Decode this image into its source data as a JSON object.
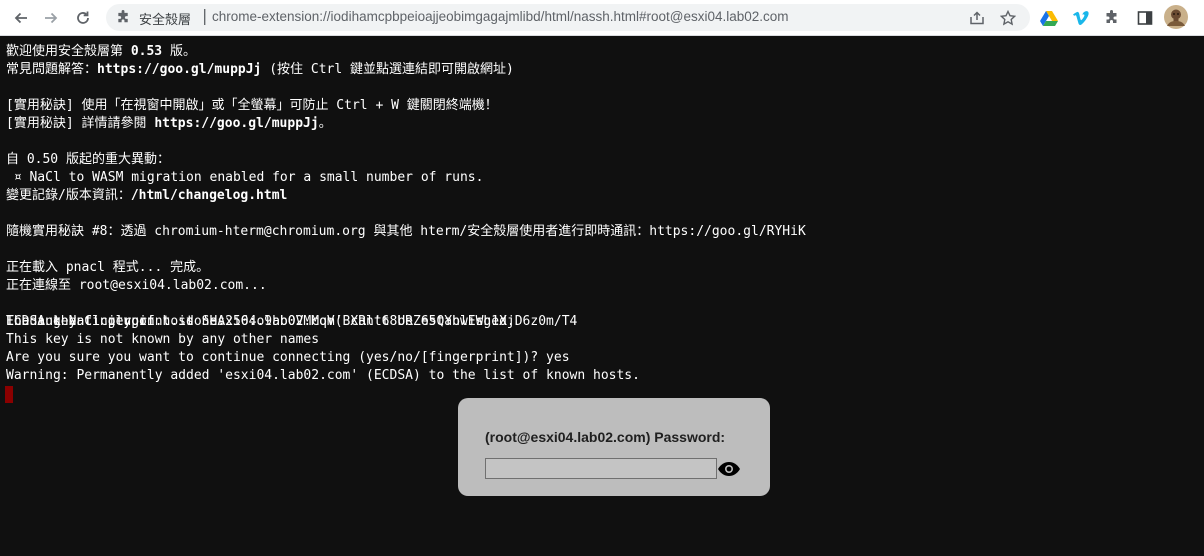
{
  "browser": {
    "omnibox": {
      "site_label": "安全殼層",
      "url": "chrome-extension://iodihamcpbpeioajjeobimgagajmlibd/html/nassh.html#root@esxi04.lab02.com"
    },
    "icons": {
      "back": "arrow-left-icon",
      "forward": "arrow-right-icon",
      "reload": "reload-icon",
      "ext": "puzzle-icon",
      "share": "share-icon",
      "bookmark": "star-icon",
      "drive": "google-drive-icon",
      "vimeo": "vimeo-icon",
      "extensions": "puzzle-icon",
      "sidepanel": "side-panel-icon",
      "avatar": "avatar-icon"
    }
  },
  "terminal": {
    "lines": {
      "l1": "歡迎使用安全殼層第 ",
      "l1_ver": "0.53",
      "l1_end": " 版。",
      "l2": "常見問題解答：",
      "l2_link": "https://goo.gl/muppJj",
      "l2_end": " (按住 Ctrl 鍵並點選連結即可開啟網址)",
      "l3": "[實用秘訣] 使用「在視窗中開啟」或「全螢幕」可防止 Ctrl + W 鍵關閉終端機！",
      "l4": "[實用秘訣] 詳情請參閱 ",
      "l4_link": "https://goo.gl/muppJj",
      "l4_end": "。",
      "l5": "自 0.50 版起的重大異動：",
      "l6": " ¤ NaCl to WASM migration enabled for a small number of runs.",
      "l7": "變更記錄/版本資訊：",
      "l7_link": "/html/changelog.html",
      "l8": "隨機實用秘訣 #8：透過 chromium-hterm@chromium.org 與其他 hterm/安全殼層使用者進行即時通訊：https://goo.gl/RYHiK",
      "l9": "正在載入 pnacl 程式... 完成。",
      "l10": "正在連線至 root@esxi04.lab02.com...",
      "l11a": "Loading NaCl plugin... done.",
      "l11b": "ECDSA key fingerprint is SHA256:o9hb0VMMqV(BXRlt68URZ65QYhwEWg1XjD6z0m/T4",
      "l11c": "The authenticity of host 'esxi04.lab02.com' can't be established.",
      "l12": "This key is not known by any other names",
      "l13": "Are you sure you want to continue connecting (yes/no/[fingerprint])? yes",
      "l14": "Warning: Permanently added 'esxi04.lab02.com' (ECDSA) to the list of known hosts."
    },
    "colors": {
      "background": "#101010",
      "foreground": "#ffffff",
      "cursor": "#8b0000"
    }
  },
  "password_dialog": {
    "label": "(root@esxi04.lab02.com) Password:",
    "value": "",
    "eye_icon": "eye-icon"
  }
}
